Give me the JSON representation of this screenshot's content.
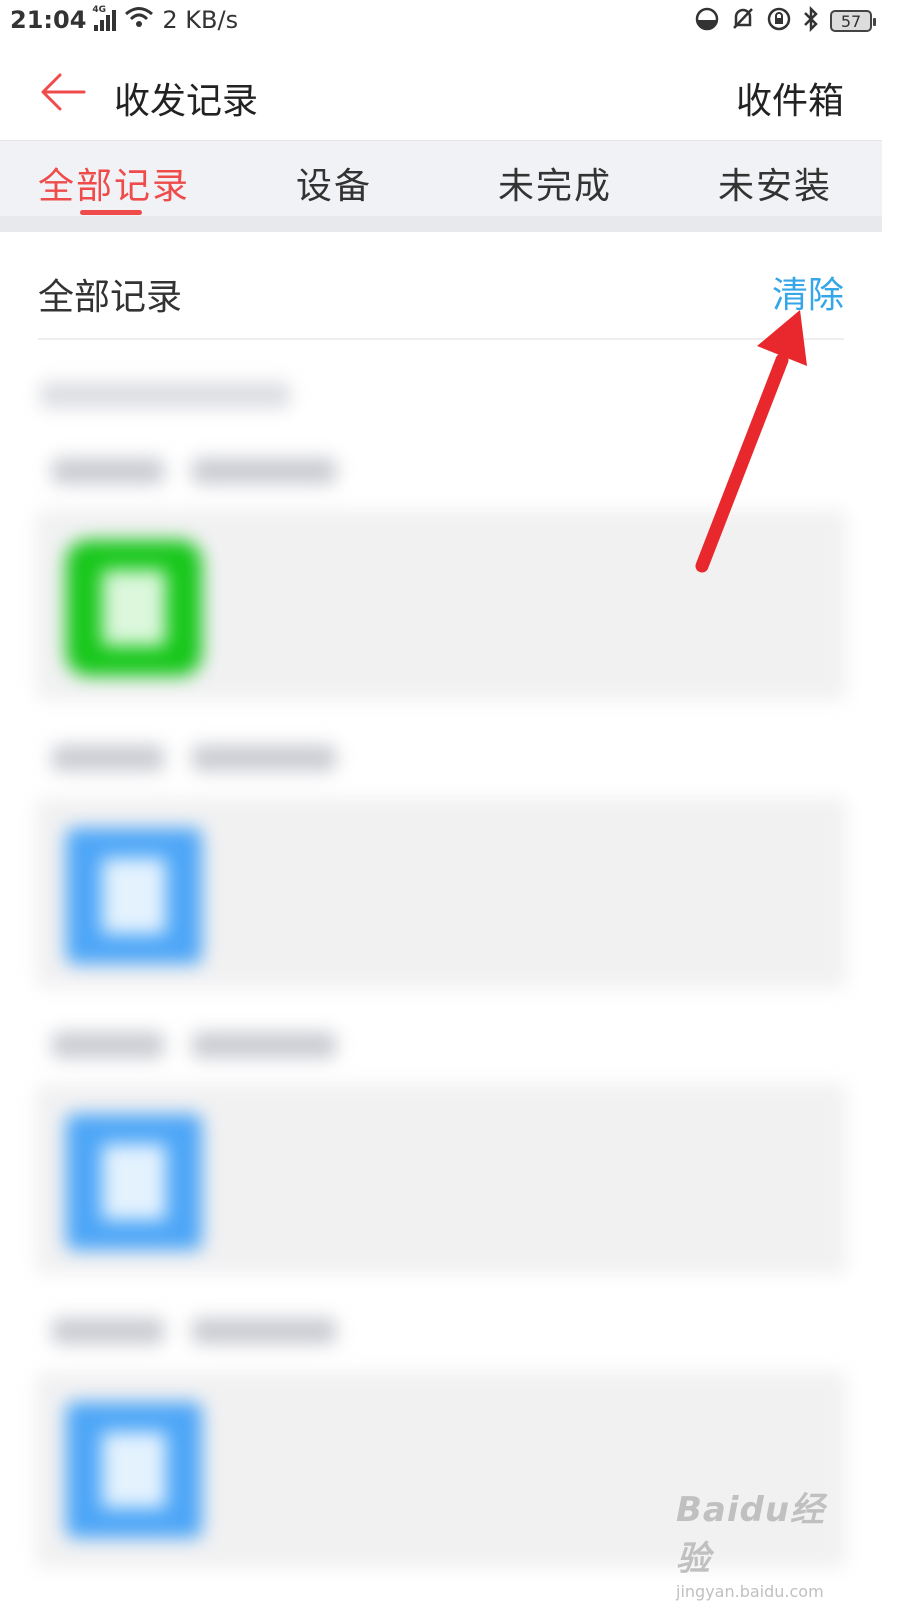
{
  "status_bar": {
    "time": "21:04",
    "network_type": "4G",
    "speed": "2 KB/s",
    "battery": "57"
  },
  "header": {
    "title": "收发记录",
    "inbox_label": "收件箱"
  },
  "tabs": [
    {
      "label": "全部记录",
      "active": true
    },
    {
      "label": "设备",
      "active": false
    },
    {
      "label": "未完成",
      "active": false
    },
    {
      "label": "未安装",
      "active": false
    }
  ],
  "section": {
    "title": "全部记录",
    "clear_label": "清除"
  },
  "records": [
    {
      "group_label": "",
      "icon": "app-book-icon",
      "name": "",
      "size": ""
    },
    {
      "group_label": "",
      "icon": "document-icon",
      "name": "",
      "size": ""
    },
    {
      "group_label": "",
      "icon": "document-icon",
      "name": "",
      "size": ""
    },
    {
      "group_label": "",
      "icon": "document-icon",
      "name": "",
      "size": ""
    }
  ],
  "watermark": {
    "brand": "Baidu经验",
    "url": "jingyan.baidu.com"
  },
  "colors": {
    "accent_red": "#ef4b4b",
    "link_blue": "#35a6e8",
    "annotation_arrow": "#e8282c"
  }
}
